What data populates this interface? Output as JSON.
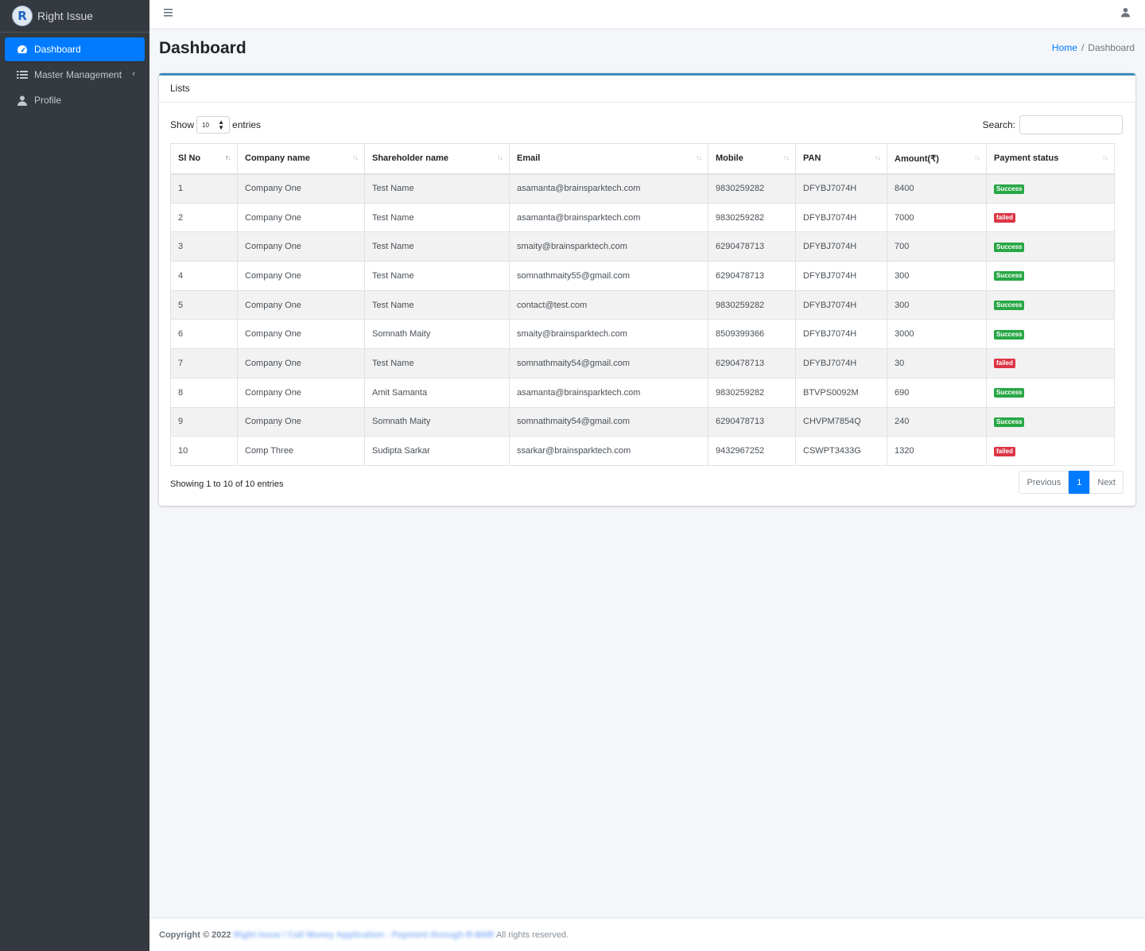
{
  "brand": {
    "logo_letter": "R",
    "name": "Right Issue"
  },
  "sidebar": {
    "items": [
      {
        "label": "Dashboard",
        "icon": "tachometer-icon",
        "active": true
      },
      {
        "label": "Master Management",
        "icon": "list-icon",
        "active": false
      },
      {
        "label": "Profile",
        "icon": "user-icon",
        "active": false
      }
    ],
    "caret": "‹"
  },
  "topbar": {
    "menu_icon": "hamburger-icon",
    "user_icon": "user-icon"
  },
  "page": {
    "title": "Dashboard",
    "breadcrumb": {
      "home": "Home",
      "separator": "/",
      "current": "Dashboard"
    }
  },
  "card": {
    "title": "Lists",
    "length": {
      "show": "Show",
      "value": "10",
      "entries": "entries"
    },
    "search": {
      "label": "Search:",
      "value": ""
    },
    "columns": [
      "Sl No",
      "Company name",
      "Shareholder name",
      "Email",
      "Mobile",
      "PAN",
      "Amount(₹)",
      "Payment status"
    ],
    "rows": [
      {
        "sl": "1",
        "company": "Company One",
        "shareholder": "Test Name",
        "email": "asamanta@brainsparktech.com",
        "mobile": "9830259282",
        "pan": "DFYBJ7074H",
        "amount": "8400",
        "status": "Success"
      },
      {
        "sl": "2",
        "company": "Company One",
        "shareholder": "Test Name",
        "email": "asamanta@brainsparktech.com",
        "mobile": "9830259282",
        "pan": "DFYBJ7074H",
        "amount": "7000",
        "status": "failed"
      },
      {
        "sl": "3",
        "company": "Company One",
        "shareholder": "Test Name",
        "email": "smaity@brainsparktech.com",
        "mobile": "6290478713",
        "pan": "DFYBJ7074H",
        "amount": "700",
        "status": "Success"
      },
      {
        "sl": "4",
        "company": "Company One",
        "shareholder": "Test Name",
        "email": "somnathmaity55@gmail.com",
        "mobile": "6290478713",
        "pan": "DFYBJ7074H",
        "amount": "300",
        "status": "Success"
      },
      {
        "sl": "5",
        "company": "Company One",
        "shareholder": "Test Name",
        "email": "contact@test.com",
        "mobile": "9830259282",
        "pan": "DFYBJ7074H",
        "amount": "300",
        "status": "Success"
      },
      {
        "sl": "6",
        "company": "Company One",
        "shareholder": "Somnath Maity",
        "email": "smaity@brainsparktech.com",
        "mobile": "8509399366",
        "pan": "DFYBJ7074H",
        "amount": "3000",
        "status": "Success"
      },
      {
        "sl": "7",
        "company": "Company One",
        "shareholder": "Test Name",
        "email": "somnathmaity54@gmail.com",
        "mobile": "6290478713",
        "pan": "DFYBJ7074H",
        "amount": "30",
        "status": "failed"
      },
      {
        "sl": "8",
        "company": "Company One",
        "shareholder": "Amit Samanta",
        "email": "asamanta@brainsparktech.com",
        "mobile": "9830259282",
        "pan": "BTVPS0092M",
        "amount": "690",
        "status": "Success"
      },
      {
        "sl": "9",
        "company": "Company One",
        "shareholder": "Somnath Maity",
        "email": "somnathmaity54@gmail.com",
        "mobile": "6290478713",
        "pan": "CHVPM7854Q",
        "amount": "240",
        "status": "Success"
      },
      {
        "sl": "10",
        "company": "Comp Three",
        "shareholder": "Sudipta Sarkar",
        "email": "ssarkar@brainsparktech.com",
        "mobile": "9432967252",
        "pan": "CSWPT3433G",
        "amount": "1320",
        "status": "failed"
      }
    ],
    "info": "Showing 1 to 10 of 10 entries",
    "pager": {
      "previous": "Previous",
      "current": "1",
      "next": "Next"
    }
  },
  "colors": {
    "primary": "#007bff",
    "sidebar": "#343a40",
    "success": "#28a745",
    "danger": "#dc3545",
    "card_top": "#3c8dbc"
  },
  "footer": {
    "copyright": "Copyright © 2022",
    "link": "Right Issue / Call Money Application - Payment through R-BNR",
    "rights": "All rights reserved."
  }
}
